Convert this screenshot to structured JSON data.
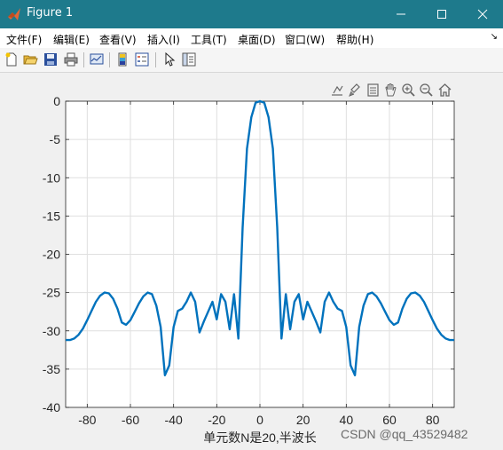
{
  "window": {
    "title": "Figure 1"
  },
  "menu": {
    "items": [
      "文件(F)",
      "编辑(E)",
      "查看(V)",
      "插入(I)",
      "工具(T)",
      "桌面(D)",
      "窗口(W)",
      "帮助(H)"
    ]
  },
  "toolbar": {
    "icons": [
      "new-figure-icon",
      "open-file-icon",
      "save-icon",
      "print-icon",
      "link-plot-icon",
      "insert-colorbar-icon",
      "insert-legend-icon",
      "edit-plot-arrow-icon",
      "property-inspector-icon"
    ]
  },
  "axes_toolbar": {
    "icons": [
      "export-icon",
      "brush-icon",
      "data-tips-icon",
      "pan-icon",
      "zoom-in-icon",
      "zoom-out-icon",
      "home-icon"
    ]
  },
  "watermark": "CSDN @qq_43529482",
  "chart_data": {
    "type": "line",
    "title": "",
    "xlabel": "单元数N是20,半波长",
    "ylabel": "",
    "xlim": [
      -90,
      90
    ],
    "ylim": [
      -40,
      0
    ],
    "xticks": [
      -80,
      -60,
      -40,
      -20,
      0,
      20,
      40,
      60,
      80
    ],
    "yticks": [
      0,
      -5,
      -10,
      -15,
      -20,
      -25,
      -30,
      -35,
      -40
    ],
    "grid": true,
    "color": "#0072bd",
    "series": [
      {
        "x": [
          -90,
          -88,
          -86,
          -84,
          -82,
          -80,
          -78,
          -76,
          -74,
          -72,
          -70,
          -68,
          -66,
          -64,
          -62,
          -60,
          -58,
          -56,
          -54,
          -52,
          -50,
          -48,
          -46,
          -44,
          -42,
          -40,
          -38,
          -36,
          -34,
          -32,
          -30,
          -28,
          -26,
          -24,
          -22,
          -20,
          -18,
          -16,
          -14,
          -12,
          -10,
          -8,
          -6,
          -4,
          -2,
          0,
          2,
          4,
          6,
          8,
          10,
          12,
          14,
          16,
          18,
          20,
          22,
          24,
          26,
          28,
          30,
          32,
          34,
          36,
          38,
          40,
          42,
          44,
          46,
          48,
          50,
          52,
          54,
          56,
          58,
          60,
          62,
          64,
          66,
          68,
          70,
          72,
          74,
          76,
          78,
          80,
          82,
          84,
          86,
          88,
          90
        ],
        "y": [
          -31.2,
          -31.2,
          -31.0,
          -30.5,
          -29.7,
          -28.6,
          -27.4,
          -26.2,
          -25.4,
          -25.0,
          -25.1,
          -25.8,
          -27.1,
          -28.9,
          -29.2,
          -28.6,
          -27.5,
          -26.4,
          -25.5,
          -25.0,
          -25.2,
          -26.7,
          -29.5,
          -35.8,
          -34.5,
          -29.5,
          -27.4,
          -27.1,
          -26.2,
          -25.0,
          -26.2,
          -30.2,
          -28.8,
          -27.5,
          -26.2,
          -28.5,
          -25.2,
          -26.2,
          -29.8,
          -25.2,
          -31.0,
          -16.5,
          -6.2,
          -2.1,
          -0.2,
          0.0,
          -0.2,
          -2.1,
          -6.2,
          -16.5,
          -31.0,
          -25.2,
          -29.8,
          -26.2,
          -25.2,
          -28.5,
          -26.2,
          -27.5,
          -28.8,
          -30.2,
          -26.2,
          -25.0,
          -26.2,
          -27.1,
          -27.4,
          -29.5,
          -34.5,
          -35.8,
          -29.5,
          -26.7,
          -25.2,
          -25.0,
          -25.5,
          -26.4,
          -27.5,
          -28.6,
          -29.2,
          -28.9,
          -27.1,
          -25.8,
          -25.1,
          -25.0,
          -25.4,
          -26.2,
          -27.4,
          -28.6,
          -29.7,
          -30.5,
          -31.0,
          -31.2,
          -31.2
        ]
      }
    ]
  }
}
